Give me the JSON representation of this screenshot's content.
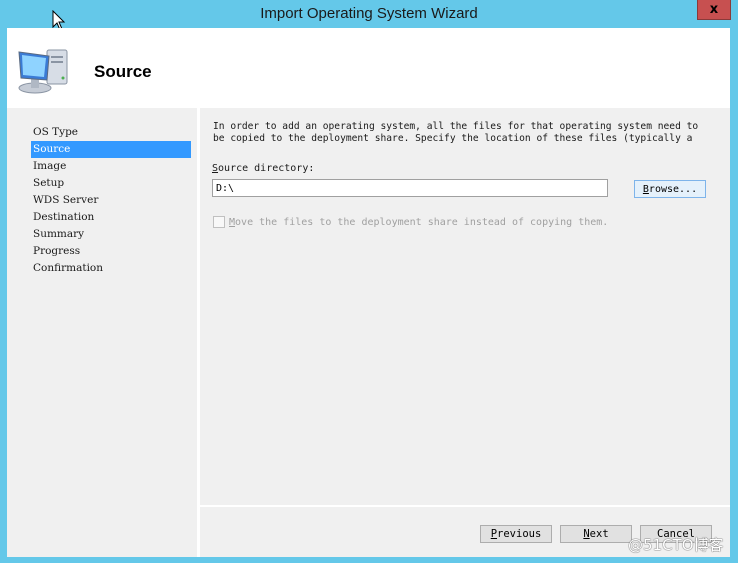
{
  "window": {
    "title": "Import Operating System Wizard",
    "close_label": "x"
  },
  "header": {
    "title": "Source",
    "icon": "computer-icon"
  },
  "nav": {
    "items": [
      {
        "label": "OS Type",
        "active": false
      },
      {
        "label": "Source",
        "active": true
      },
      {
        "label": "Image",
        "active": false
      },
      {
        "label": "Setup",
        "active": false
      },
      {
        "label": "WDS Server",
        "active": false
      },
      {
        "label": "Destination",
        "active": false
      },
      {
        "label": "Summary",
        "active": false
      },
      {
        "label": "Progress",
        "active": false
      },
      {
        "label": "Confirmation",
        "active": false
      }
    ]
  },
  "content": {
    "intro_line1": "In order to add an operating system, all the files for that operating system need to",
    "intro_line2": "be copied to the deployment share.  Specify the location of these files (typically a",
    "source_label_first": "S",
    "source_label_rest": "ource directory:",
    "source_value": "D:\\",
    "browse_first": "B",
    "browse_rest": "rowse...",
    "move_first": "M",
    "move_rest": "ove the files to the deployment share instead of copying them.",
    "move_checked": false,
    "move_enabled": false
  },
  "footer": {
    "previous_first": "P",
    "previous_rest": "revious",
    "next_first": "N",
    "next_rest": "ext",
    "cancel_label": "Cancel"
  },
  "watermark": "@51CTO博客"
}
